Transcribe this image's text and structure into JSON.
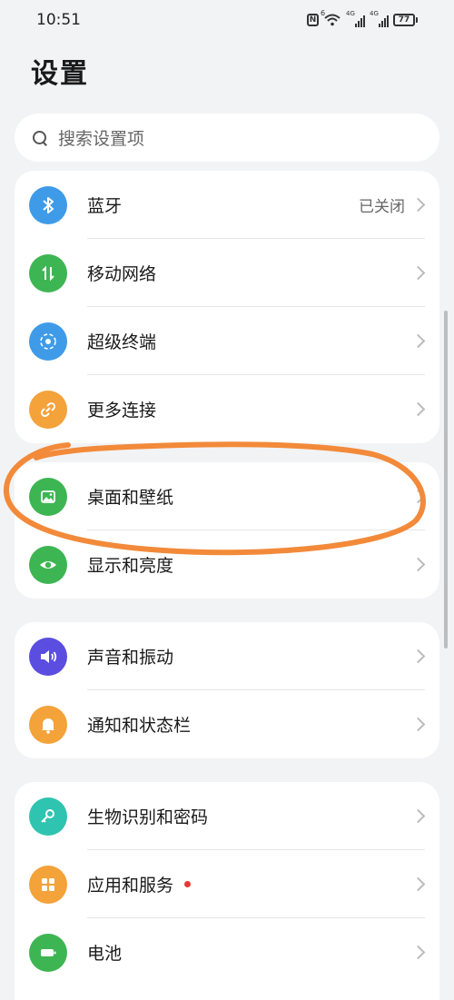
{
  "status_bar": {
    "time": "10:51",
    "nfc": "N",
    "wifi_badge": "6",
    "signal1_label": "4G",
    "signal2_label": "4G",
    "battery": "77"
  },
  "page": {
    "title": "设置"
  },
  "search": {
    "placeholder": "搜索设置项"
  },
  "groups": [
    {
      "items": [
        {
          "label": "蓝牙",
          "value": "已关闭",
          "icon": "bluetooth-icon",
          "color": "#3f9be8"
        },
        {
          "label": "移动网络",
          "icon": "mobile-data-icon",
          "color": "#3eb553"
        },
        {
          "label": "超级终端",
          "icon": "super-device-icon",
          "color": "#3f9be8"
        },
        {
          "label": "更多连接",
          "icon": "link-icon",
          "color": "#f4a23a"
        }
      ]
    },
    {
      "items": [
        {
          "label": "桌面和壁纸",
          "icon": "wallpaper-icon",
          "color": "#3eb553"
        },
        {
          "label": "显示和亮度",
          "icon": "eye-icon",
          "color": "#3eb553"
        }
      ]
    },
    {
      "items": [
        {
          "label": "声音和振动",
          "icon": "volume-icon",
          "color": "#5b4de0"
        },
        {
          "label": "通知和状态栏",
          "icon": "bell-icon",
          "color": "#f4a23a"
        }
      ]
    },
    {
      "items": [
        {
          "label": "生物识别和密码",
          "icon": "key-icon",
          "color": "#2ec4b0"
        },
        {
          "label": "应用和服务",
          "icon": "apps-icon",
          "color": "#f4a23a",
          "badge": "red-dot"
        },
        {
          "label": "电池",
          "icon": "battery-icon",
          "color": "#3eb553"
        }
      ]
    }
  ],
  "annotation": {
    "color": "#f28a3a"
  }
}
